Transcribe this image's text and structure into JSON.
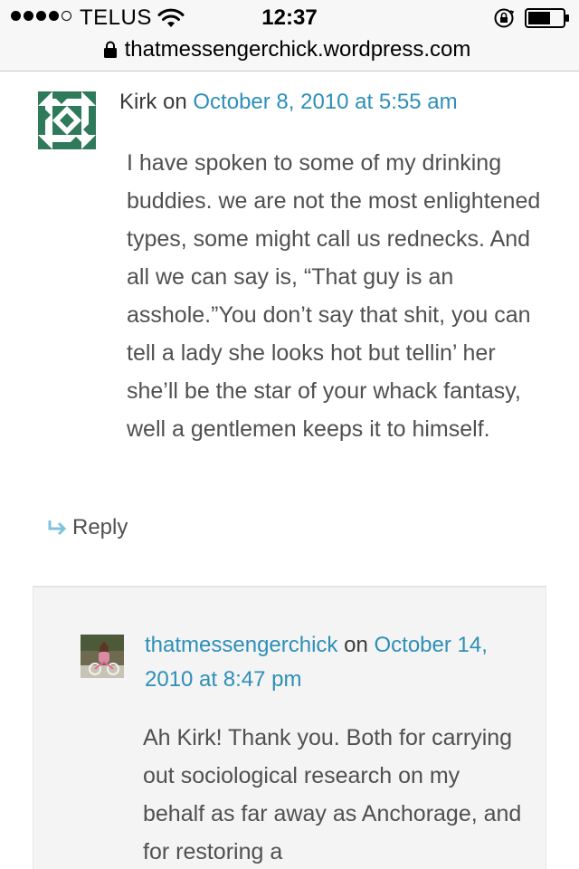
{
  "status_bar": {
    "carrier": "TELUS",
    "time": "12:37",
    "signal_bars_filled": 4,
    "signal_bars_total": 5
  },
  "browser": {
    "url": "thatmessengerchick.wordpress.com"
  },
  "comments": [
    {
      "author": "Kirk",
      "on": "on",
      "date": "October 8, 2010 at 5:55 am",
      "body": "I have spoken to some of my drinking buddies. we are not the most enlightened types, some might call us rednecks. And all we can say is, “That guy is an asshole.”You don’t say that shit, you can tell a lady she looks hot but tellin’ her she’ll be the star of your whack fantasy, well a gentlemen keeps it to himself.",
      "reply_label": "Reply"
    },
    {
      "author": "thatmessengerchick",
      "on": "on",
      "date": "October 14, 2010 at 8:47 pm",
      "body": "Ah Kirk! Thank you. Both for carrying out sociological research on my behalf as far away as Anchorage, and for restoring a"
    }
  ],
  "colors": {
    "link": "#2e8fb8",
    "text": "#505050",
    "avatar_green": "#2f7a5a",
    "reply_arrow": "#7ec3dc",
    "nested_bg": "#f4f4f4"
  },
  "icons": {
    "wifi": "wifi-icon",
    "rotation_lock": "rotation-lock-icon",
    "battery": "battery-icon",
    "lock": "lock-icon",
    "reply": "reply-arrow-icon"
  }
}
